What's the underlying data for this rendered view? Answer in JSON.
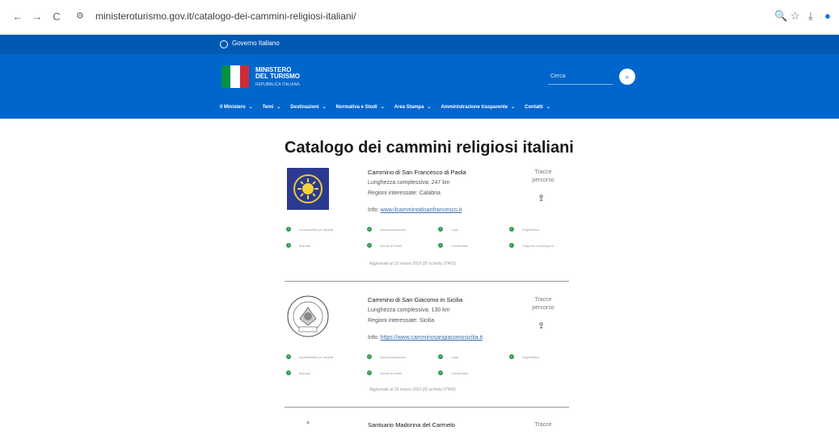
{
  "browser": {
    "back": "←",
    "forward": "→",
    "reload": "C",
    "site_info": "⚙",
    "url": "ministeroturismo.gov.it/catalogo-dei-cammini-religiosi-italiani/",
    "icons": {
      "zoom": "🔍",
      "star": "☆",
      "download": "⤓",
      "profile": "●"
    }
  },
  "gov_bar": {
    "label": "Governo Italiano"
  },
  "header": {
    "ministry_line1": "MINISTERO",
    "ministry_line2": "DEL TURISMO",
    "ministry_sub": "REPUBBLICA ITALIANA",
    "search_placeholder": "Cerca",
    "search_icon": "⌕",
    "flag_colors": [
      "#009246",
      "#ffffff",
      "#ce2b37"
    ]
  },
  "nav": {
    "items": [
      "Il Ministero",
      "Temi",
      "Destinazioni",
      "Normativa e Studi",
      "Area Stampa",
      "Amministrazione trasparente",
      "Contatti"
    ],
    "chevron": "⌄"
  },
  "page": {
    "title": "Catalogo dei cammini religiosi italiani"
  },
  "cammini": [
    {
      "title": "Cammino di San Francesco di Paola",
      "length": "Lunghezza complessiva: 247 km",
      "regions": "Regioni interessate: Calabria",
      "info_label": "Info: ",
      "info_link": "www.ilcamminodisanfrancesco.it",
      "tracce": "Tracce percorso",
      "cloud_icon": "⇪",
      "features": [
        "Accessibilità per disabili",
        "Geolocalizzazione",
        "Logo",
        "Segnaletica",
        "Manuali",
        "Servizi ai fedeli",
        "Credenziale",
        "Supporto al pellegrino"
      ],
      "updated": "Aggiornato al 23 marzo 2023 (ID scheda 37403)"
    },
    {
      "title": "Cammino di San Giacomo in Sicilia",
      "length": "Lunghezza complessiva: 130 km",
      "regions": "Regioni interessate: Sicilia",
      "info_label": "Info: ",
      "info_link": "https://www.camminosangiacomosicilia.it",
      "tracce": "Tracce percorso",
      "cloud_icon": "⇪",
      "features": [
        "Accessibilità per disabili",
        "Geolocalizzazione",
        "Logo",
        "Segnaletica",
        "Manuali",
        "Servizi ai fedeli",
        "Credenziale"
      ],
      "updated": "Aggiornato al 23 marzo 2023 (ID scheda 37405)"
    },
    {
      "title": "Santuario Madonna del Carmelo",
      "tracce": "Tracce"
    }
  ]
}
